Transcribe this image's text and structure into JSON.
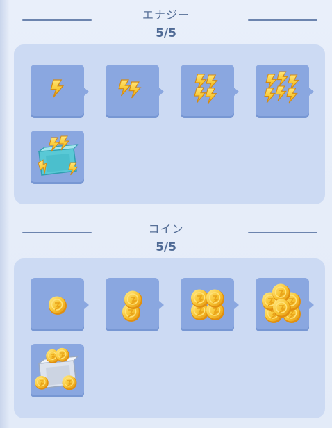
{
  "sections": [
    {
      "title": "エナジー",
      "count": "5/5",
      "items": [
        {
          "icon": "energy-1-icon"
        },
        {
          "icon": "energy-2-icon"
        },
        {
          "icon": "energy-3-icon"
        },
        {
          "icon": "energy-4-icon"
        },
        {
          "icon": "energy-crate-icon"
        }
      ]
    },
    {
      "title": "コイン",
      "count": "5/5",
      "items": [
        {
          "icon": "coin-1-icon"
        },
        {
          "icon": "coin-2-icon"
        },
        {
          "icon": "coin-3-icon"
        },
        {
          "icon": "coin-4-icon"
        },
        {
          "icon": "coin-crate-icon"
        }
      ]
    }
  ],
  "colors": {
    "panel": "#ccdaf3",
    "tile": "#8aa7e0",
    "gold": "#f4c431",
    "header_text": "#566f97"
  }
}
